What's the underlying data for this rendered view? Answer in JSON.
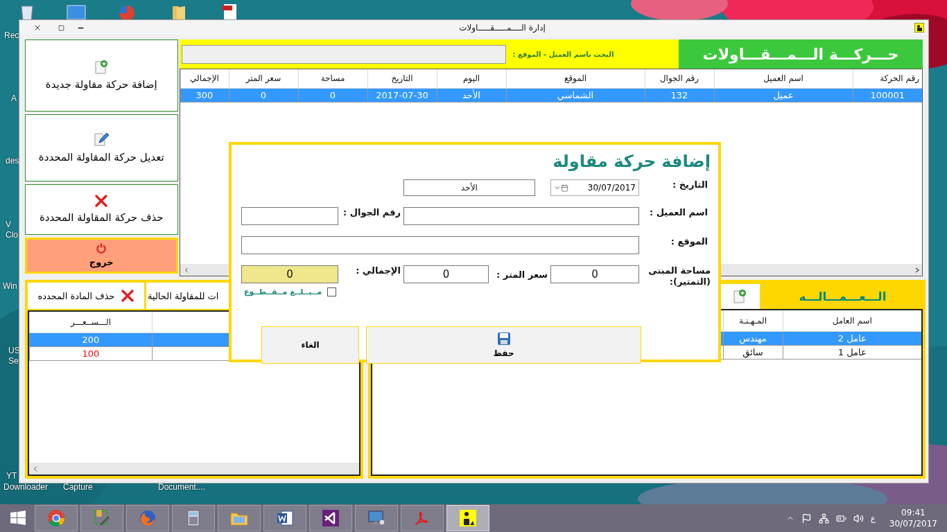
{
  "window": {
    "title": "إدارة الــــمـــــقـــــاولات"
  },
  "desktop_icons": [
    {
      "lines": [
        "Rec"
      ]
    },
    {
      "lines": [
        "A"
      ]
    },
    {
      "lines": [
        "des"
      ]
    },
    {
      "lines": [
        "V",
        "Clo"
      ]
    },
    {
      "lines": [
        "Win"
      ]
    },
    {
      "lines": [
        "US",
        "Se"
      ]
    },
    {
      "lines": [
        "YT"
      ]
    },
    {
      "lines": [
        "Document...."
      ]
    },
    {
      "lines": [
        "Capture"
      ]
    },
    {
      "lines": [
        "Downloader"
      ]
    }
  ],
  "actions": [
    {
      "kind": "add",
      "label": "إضافة حركة مقاولة جديدة"
    },
    {
      "kind": "edit",
      "label": "تعديل حركة المقاولة المحددة"
    },
    {
      "kind": "delete",
      "label": "حذف حركة المقاولة المحددة"
    },
    {
      "kind": "exit",
      "label": "خروج"
    }
  ],
  "header": {
    "title": "حـــركـــة الـــمـــقـــاولات",
    "search_label": "البحث باسم العميل - الموقع :"
  },
  "table": {
    "columns": [
      "رقم الحركة",
      "اسم العميل",
      "رقم الجوال",
      "الموقع",
      "اليوم",
      "التاريخ",
      "مساحة",
      "سعر المتر",
      "الإجمالي"
    ],
    "rows": [
      {
        "cells": [
          "100001",
          "عميل",
          "132",
          "الشماسي",
          "الأحد",
          "2017-07-30",
          "0",
          "0",
          "300"
        ],
        "selected": true
      }
    ]
  },
  "materials": {
    "buttons": [
      {
        "kind": "text",
        "label": "ات للمقاولة الحالية"
      },
      {
        "kind": "delete",
        "label": "حذف المادة المحدده"
      }
    ],
    "columns": [
      "الـــســعـــر"
    ],
    "rows": [
      {
        "price": "200",
        "selected": true,
        "highlight": false
      },
      {
        "price": "100",
        "selected": false,
        "highlight": true
      }
    ]
  },
  "workers": {
    "title": "الـــعـــمـــالـــه",
    "columns": [
      "اسم العامل",
      "المـهـنـة"
    ],
    "rows": [
      {
        "cells": [
          "عامل 2",
          "مهندس"
        ],
        "selected": true
      },
      {
        "cells": [
          "عامل 1",
          "سائق"
        ],
        "selected": false
      }
    ]
  },
  "dialog": {
    "title": "إضافة حركة مقاولة",
    "date_label": "التاريخ :",
    "date": "30/07/2017",
    "day": "الأحد",
    "client_label": "اسم العميل :",
    "phone_label": "رقم الجوال :",
    "location_label": "الموقع :",
    "area_label": "مساحة المبنى (التمتير):",
    "area": "0",
    "price_label": "سعر المتر :",
    "price": "0",
    "total_label": "الإجمالي :",
    "total": "0",
    "lump_sum": {
      "label": "مــبــلــغ مــقــطــوع",
      "checked": false
    },
    "save": "حفظ",
    "cancel": "الغاء"
  },
  "taskbar": {
    "apps": [
      {
        "kind": "chrome",
        "active": false
      },
      {
        "kind": "tools",
        "active": false
      },
      {
        "kind": "firefox",
        "active": false
      },
      {
        "kind": "calculator",
        "active": false
      },
      {
        "kind": "folder",
        "active": false
      },
      {
        "kind": "word",
        "active": false
      },
      {
        "kind": "vs",
        "active": false
      },
      {
        "kind": "monitor",
        "active": false
      },
      {
        "kind": "pdf",
        "active": false
      },
      {
        "kind": "worker",
        "active": true
      }
    ],
    "ime": "ع",
    "time": "09:41",
    "date": "30/07/2017"
  }
}
